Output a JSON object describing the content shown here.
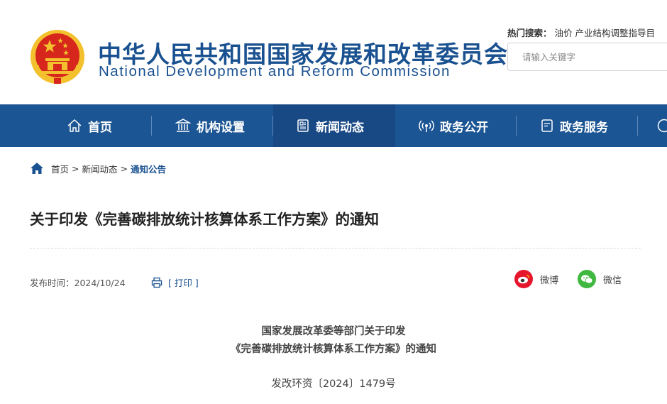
{
  "header": {
    "title_cn": "中华人民共和国国家发展和改革委员会",
    "title_en": "National Development and Reform Commission",
    "hot_search_label": "热门搜索：",
    "hot_search_keywords": [
      "油价",
      "产业结构调整指导目"
    ],
    "search_placeholder": "请输入关键字"
  },
  "nav": {
    "items": [
      {
        "label": "首页",
        "icon": "home-icon"
      },
      {
        "label": "机构设置",
        "icon": "building-icon"
      },
      {
        "label": "新闻动态",
        "icon": "news-icon",
        "active": true
      },
      {
        "label": "政务公开",
        "icon": "broadcast-icon"
      },
      {
        "label": "政务服务",
        "icon": "service-icon"
      }
    ]
  },
  "breadcrumb": {
    "items": [
      "首页",
      "新闻动态"
    ],
    "separator": ">",
    "current": "通知公告"
  },
  "article": {
    "title": "关于印发《完善碳排放统计核算体系工作方案》的通知",
    "publish_date": "发布时间：2024/10/24",
    "print_label": "[ 打印 ]",
    "share": [
      {
        "label": "微博",
        "icon": "weibo-icon",
        "color": "#e6162d"
      },
      {
        "label": "微信",
        "icon": "wechat-icon",
        "color": "#3fb83f"
      }
    ],
    "heading_line1": "国家发展改革委等部门关于印发",
    "heading_line2": "《完善碳排放统计核算体系工作方案》的通知",
    "doc_number": "发改环资〔2024〕1479号"
  },
  "colors": {
    "brand": "#1c5594",
    "nav_active": "#184985",
    "emblem_red": "#d7261c",
    "emblem_gold": "#f3c12d"
  }
}
